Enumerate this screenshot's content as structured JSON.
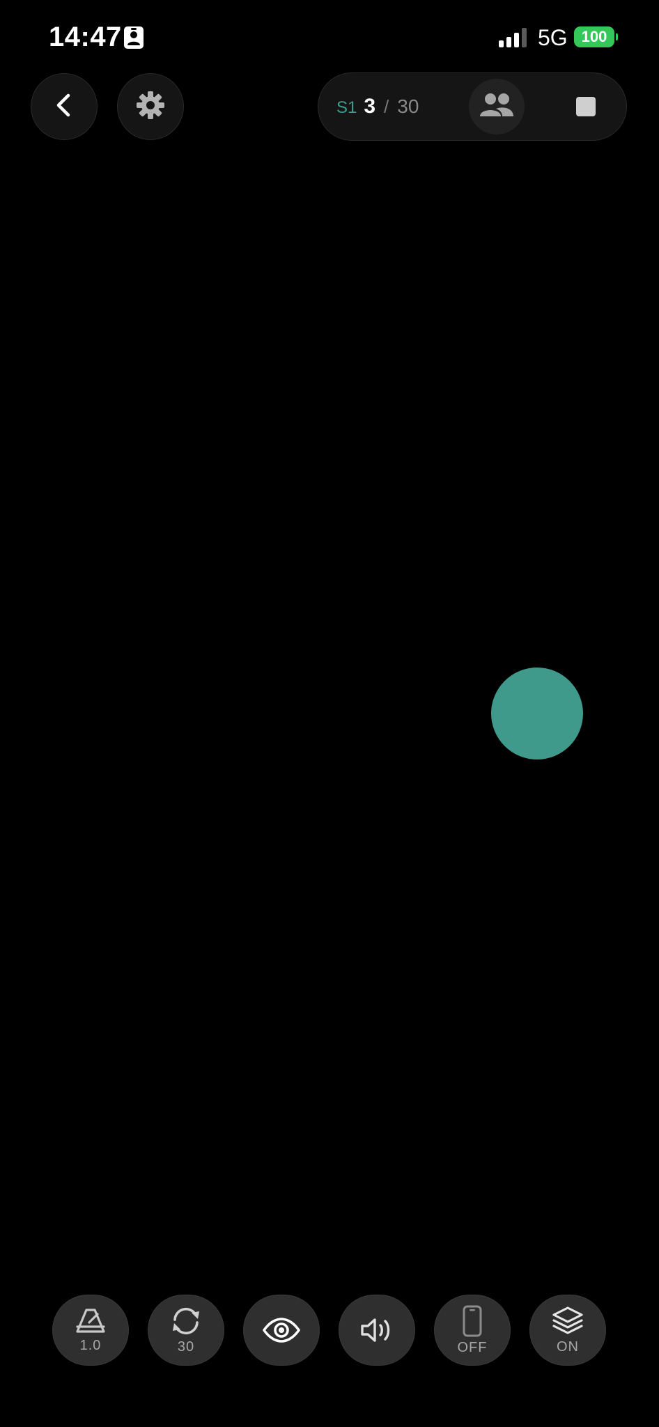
{
  "status_bar": {
    "time": "14:47",
    "network": "5G",
    "battery": "100",
    "icons": [
      "contact-card-icon",
      "cellular-signal-icon",
      "battery-icon"
    ]
  },
  "top_bar": {
    "back_icon": "chevron-left-icon",
    "settings_icon": "gear-icon",
    "session": {
      "label": "S1",
      "current": "3",
      "separator": "/",
      "total": "30"
    },
    "participants_icon": "people-icon",
    "stop_icon": "stop-square-icon"
  },
  "canvas": {
    "target_color": "#3f9a8b"
  },
  "toolbar": {
    "items": [
      {
        "icon": "metronome-icon",
        "label": "1.0"
      },
      {
        "icon": "repeat-icon",
        "label": "30"
      },
      {
        "icon": "eye-icon",
        "label": ""
      },
      {
        "icon": "speaker-icon",
        "label": ""
      },
      {
        "icon": "phone-icon",
        "label": "OFF"
      },
      {
        "icon": "layers-icon",
        "label": "ON"
      }
    ]
  },
  "colors": {
    "accent": "#3f9d8d",
    "battery": "#34c759",
    "background": "#000000"
  }
}
